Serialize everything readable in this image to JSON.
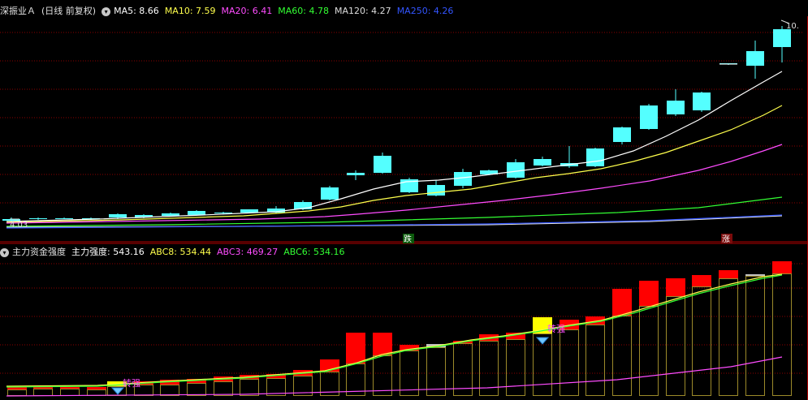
{
  "price_panel": {
    "title": "深振业Ａ",
    "mode": "(日线 前复权)",
    "ma": [
      {
        "label": "MA5: 8.66",
        "color": "#ffffff"
      },
      {
        "label": "MA10: 7.59",
        "color": "#ffff4c"
      },
      {
        "label": "MA20: 6.41",
        "color": "#ff4cff"
      },
      {
        "label": "MA60: 4.78",
        "color": "#33ff33"
      },
      {
        "label": "MA120: 4.27",
        "color": "#dddddd"
      },
      {
        "label": "MA250: 4.26",
        "color": "#3355ff"
      }
    ],
    "low_label": "4.03",
    "high_label": "10.",
    "down_badge": "跌",
    "up_badge": "涨"
  },
  "indicator_panel": {
    "title": "主力资金强度",
    "main_label": "主力强度: 543.16",
    "lines": [
      {
        "label": "ABC8: 534.44",
        "color": "#ffff4c"
      },
      {
        "label": "ABC3: 469.27",
        "color": "#ff4cff"
      },
      {
        "label": "ABC6: 534.16",
        "color": "#33ff33"
      }
    ],
    "signal_text": "转强"
  },
  "colors": {
    "up": "#ff3030",
    "down": "#54ffff",
    "grid": "#8b0000",
    "frame": "#b00000",
    "bar_up": "#ff0000",
    "bar_signal": "#ffff00",
    "bar_neutral": "#c0c0c0",
    "envelope": "#9c8a2a"
  }
}
